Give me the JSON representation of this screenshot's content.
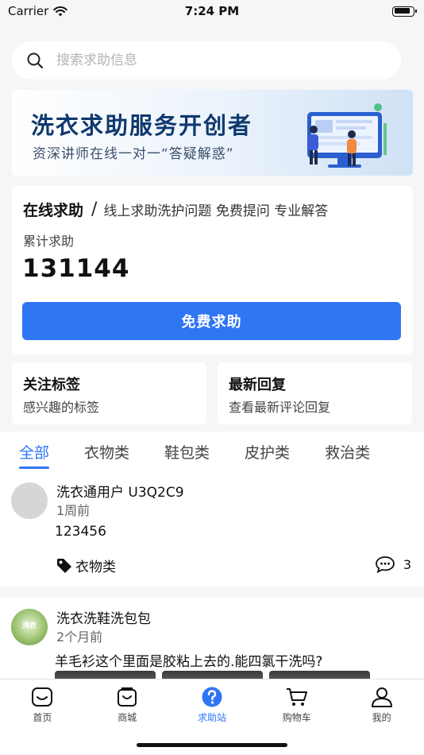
{
  "status": {
    "carrier": "Carrier",
    "time": "7:24 PM"
  },
  "search": {
    "placeholder": "搜索求助信息"
  },
  "banner": {
    "title": "洗衣求助服务开创者",
    "subtitle": "资深讲师在线一对一“答疑解惑”"
  },
  "help": {
    "title": "在线求助",
    "separator": "/",
    "description": "线上求助洗护问题 免费提问 专业解答",
    "count_label": "累计求助",
    "count": "131144",
    "button_label": "免费求助"
  },
  "cards": [
    {
      "title": "关注标签",
      "subtitle": "感兴趣的标签"
    },
    {
      "title": "最新回复",
      "subtitle": "查看最新评论回复"
    }
  ],
  "tabs": [
    {
      "label": "全部",
      "active": true
    },
    {
      "label": "衣物类"
    },
    {
      "label": "鞋包类"
    },
    {
      "label": "皮护类"
    },
    {
      "label": "救治类"
    }
  ],
  "posts": [
    {
      "user": "洗衣通用户 U3Q2C9",
      "time": "1周前",
      "text": "123456",
      "tag": "衣物类",
      "comments": "3"
    },
    {
      "user": "洗衣洗鞋洗包包",
      "time": "2个月前",
      "text": "羊毛衫这个里面是胶粘上去的.能四氯干洗吗?",
      "avatar_text": "洗衣"
    }
  ],
  "nav": [
    {
      "label": "首页",
      "icon": "home-icon"
    },
    {
      "label": "商城",
      "icon": "shopping-bag-icon"
    },
    {
      "label": "求助站",
      "icon": "help-circle-icon",
      "active": true
    },
    {
      "label": "购物车",
      "icon": "cart-icon"
    },
    {
      "label": "我的",
      "icon": "user-icon"
    }
  ],
  "colors": {
    "accent": "#2f76f5",
    "background": "#f5f6f8",
    "banner_title": "#0e3a6e"
  }
}
